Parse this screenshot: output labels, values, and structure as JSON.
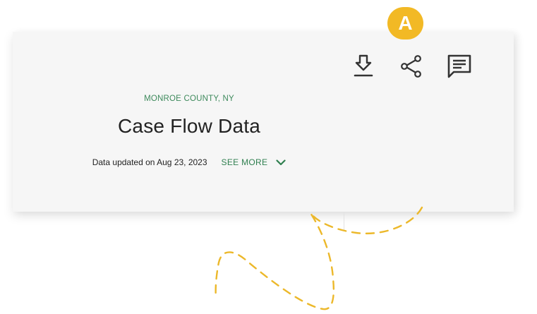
{
  "callout": {
    "badge_label": "A",
    "badge_color": "#f2b925"
  },
  "header": {
    "county": "MONROE COUNTY, NY",
    "title": "Case Flow Data",
    "updated_text": "Data updated on Aug 23, 2023",
    "see_more_label": "SEE MORE",
    "accent_color": "#3e8a5c"
  },
  "actions": [
    {
      "name": "download",
      "icon": "download-icon"
    },
    {
      "name": "share",
      "icon": "share-icon"
    },
    {
      "name": "comment",
      "icon": "comment-icon"
    }
  ]
}
